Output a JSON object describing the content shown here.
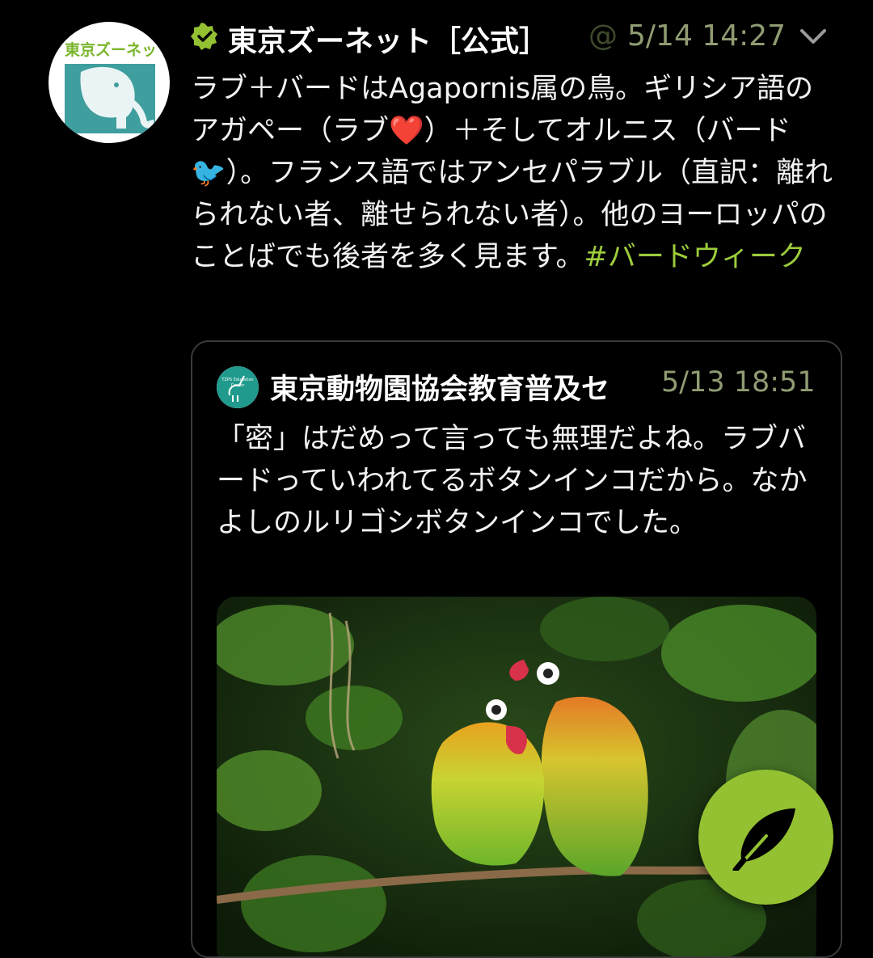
{
  "tweet": {
    "author_name": "東京ズーネット［公式］",
    "handle_fragment": "@",
    "timestamp": "5/14 14:27",
    "avatar_logo_text": "東京ズーネット",
    "text_segments": [
      "ラブ＋バードはAgapornis属の鳥。ギリシア語のアガペー（ラブ",
      "❤️",
      "）＋そしてオルニス（バード",
      "🐦",
      "）。フランス語ではアンセパラブル（直訳：離れられない者、離せられない者）。他のヨーロッパのことばでも後者を多く見ます。"
    ],
    "hashtag": "#バードウィーク",
    "icons": {
      "verified": "verified-badge-icon",
      "menu": "chevron-down-icon"
    }
  },
  "quoted_tweet": {
    "author_name": "東京動物園協会教育普及セ",
    "timestamp": "5/13 18:51",
    "avatar_logo_text": "TZPS Education Center",
    "text": "「密」はだめって言っても無理だよね。ラブバードっていわれてるボタンインコだから。なかよしのルリゴシボタンインコでした。"
  },
  "compose_button": {
    "icon": "feather-icon"
  },
  "colors": {
    "background": "#000000",
    "accent": "#94c132",
    "hashtag": "#9ccc3c",
    "meta_text": "#8f9c72"
  }
}
